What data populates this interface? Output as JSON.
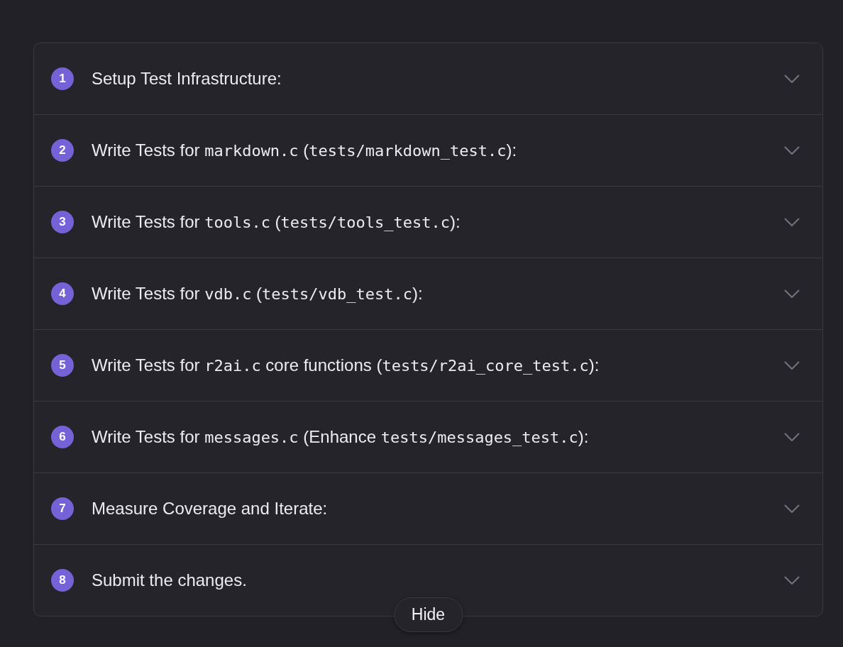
{
  "steps": [
    {
      "number": "1",
      "expanded": false,
      "title": [
        {
          "kind": "plain",
          "text": "Setup Test Infrastructure:"
        }
      ]
    },
    {
      "number": "2",
      "expanded": false,
      "title": [
        {
          "kind": "plain",
          "text": "Write Tests for "
        },
        {
          "kind": "code",
          "text": "markdown.c"
        },
        {
          "kind": "plain",
          "text": " ("
        },
        {
          "kind": "code",
          "text": "tests/markdown_test.c"
        },
        {
          "kind": "plain",
          "text": "):"
        }
      ]
    },
    {
      "number": "3",
      "expanded": false,
      "title": [
        {
          "kind": "plain",
          "text": "Write Tests for "
        },
        {
          "kind": "code",
          "text": "tools.c"
        },
        {
          "kind": "plain",
          "text": " ("
        },
        {
          "kind": "code",
          "text": "tests/tools_test.c"
        },
        {
          "kind": "plain",
          "text": "):"
        }
      ]
    },
    {
      "number": "4",
      "expanded": false,
      "title": [
        {
          "kind": "plain",
          "text": "Write Tests for "
        },
        {
          "kind": "code",
          "text": "vdb.c"
        },
        {
          "kind": "plain",
          "text": " ("
        },
        {
          "kind": "code",
          "text": "tests/vdb_test.c"
        },
        {
          "kind": "plain",
          "text": "):"
        }
      ]
    },
    {
      "number": "5",
      "expanded": false,
      "title": [
        {
          "kind": "plain",
          "text": "Write Tests for "
        },
        {
          "kind": "code",
          "text": "r2ai.c"
        },
        {
          "kind": "plain",
          "text": " core functions ("
        },
        {
          "kind": "code",
          "text": "tests/r2ai_core_test.c"
        },
        {
          "kind": "plain",
          "text": "):"
        }
      ]
    },
    {
      "number": "6",
      "expanded": false,
      "title": [
        {
          "kind": "plain",
          "text": "Write Tests for "
        },
        {
          "kind": "code",
          "text": "messages.c"
        },
        {
          "kind": "plain",
          "text": " (Enhance "
        },
        {
          "kind": "code",
          "text": "tests/messages_test.c"
        },
        {
          "kind": "plain",
          "text": "):"
        }
      ]
    },
    {
      "number": "7",
      "expanded": false,
      "title": [
        {
          "kind": "plain",
          "text": "Measure Coverage and Iterate:"
        }
      ]
    },
    {
      "number": "8",
      "expanded": false,
      "title": [
        {
          "kind": "plain",
          "text": "Submit the changes."
        }
      ]
    }
  ],
  "hide_button": {
    "label": "Hide"
  }
}
